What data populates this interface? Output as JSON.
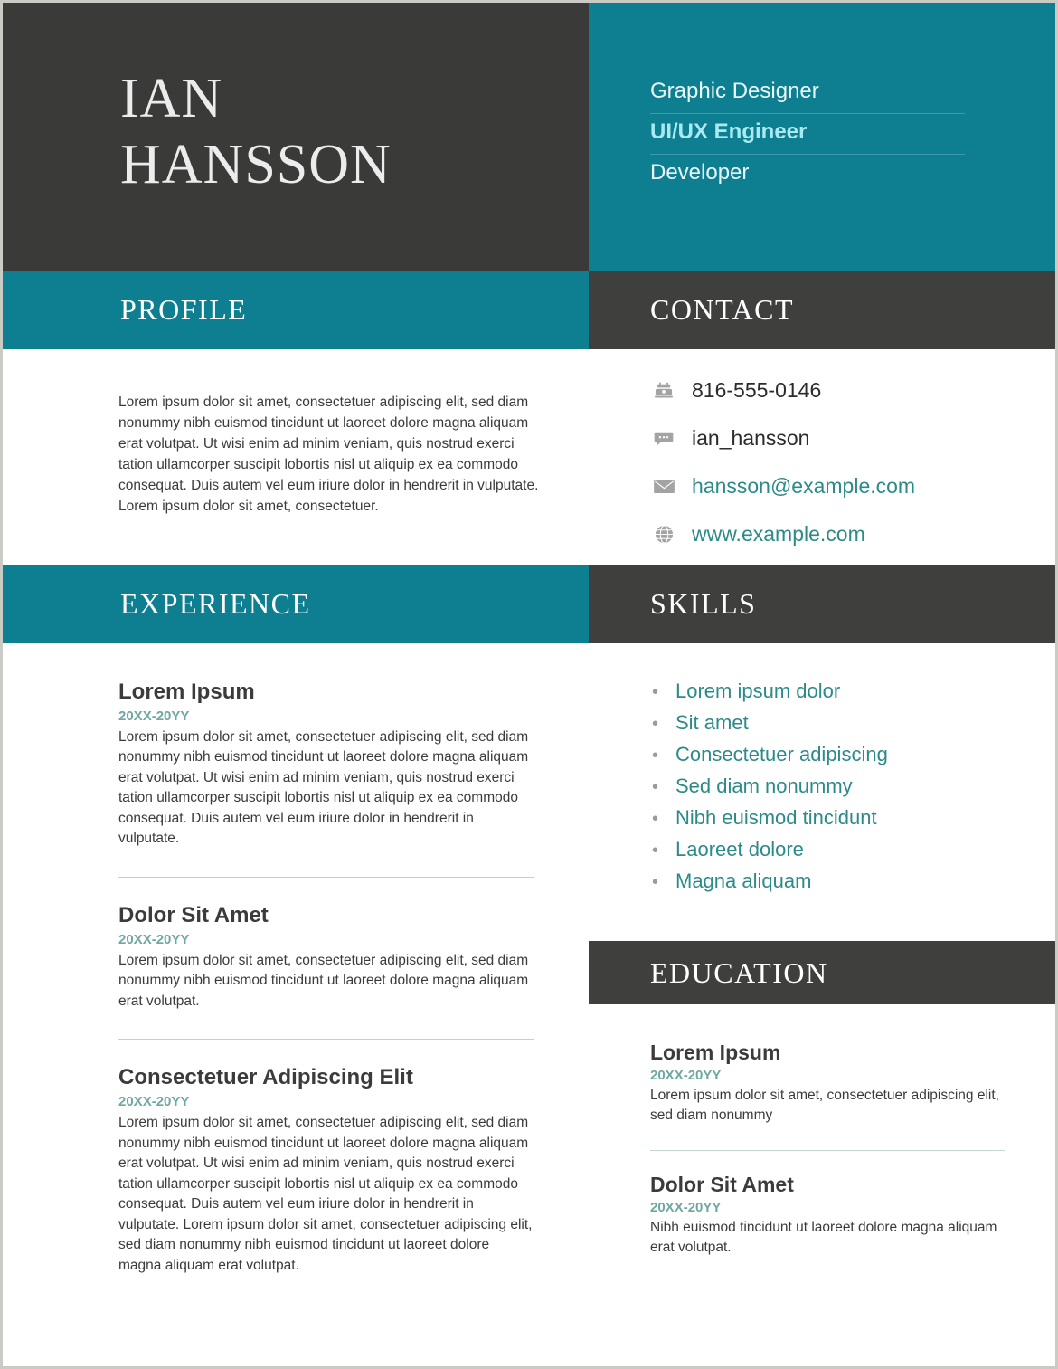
{
  "header": {
    "name_line1": "IAN",
    "name_line2": "HANSSON",
    "titles": [
      {
        "label": "Graphic Designer",
        "emphasis": false
      },
      {
        "label": "UI/UX Engineer",
        "emphasis": true
      },
      {
        "label": "Developer",
        "emphasis": false
      }
    ]
  },
  "colors": {
    "teal": "#0E7E91",
    "dark": "#3A3A38",
    "text_teal": "#2C8A88",
    "date_teal": "#6FA7A4",
    "accent_cyan": "#A9EAF2"
  },
  "profile": {
    "heading": "PROFILE",
    "text": "Lorem ipsum dolor sit amet, consectetuer adipiscing elit, sed diam nonummy nibh euismod tincidunt ut laoreet dolore magna aliquam erat volutpat. Ut wisi enim ad minim veniam, quis nostrud exerci tation ullamcorper suscipit lobortis nisl ut aliquip ex ea commodo consequat. Duis autem vel eum iriure dolor in hendrerit in vulputate. Lorem ipsum dolor sit amet, consectetuer."
  },
  "contact": {
    "heading": "CONTACT",
    "items": [
      {
        "icon": "phone-icon",
        "value": "816-555-0146",
        "is_link": false
      },
      {
        "icon": "chat-bubble-icon",
        "value": "ian_hansson",
        "is_link": false
      },
      {
        "icon": "envelope-icon",
        "value": "hansson@example.com",
        "is_link": true
      },
      {
        "icon": "globe-icon",
        "value": "www.example.com",
        "is_link": true
      }
    ]
  },
  "experience": {
    "heading": "EXPERIENCE",
    "entries": [
      {
        "title": "Lorem Ipsum",
        "date": "20XX-20YY",
        "description": "Lorem ipsum dolor sit amet, consectetuer adipiscing elit, sed diam nonummy nibh euismod tincidunt ut laoreet dolore magna aliquam erat volutpat. Ut wisi enim ad minim veniam, quis nostrud exerci tation ullamcorper suscipit lobortis nisl ut aliquip ex ea commodo consequat. Duis autem vel eum iriure dolor in hendrerit in vulputate."
      },
      {
        "title": "Dolor Sit Amet",
        "date": "20XX-20YY",
        "description": "Lorem ipsum dolor sit amet, consectetuer adipiscing elit, sed diam nonummy nibh euismod tincidunt ut laoreet dolore magna aliquam erat volutpat."
      },
      {
        "title": "Consectetuer Adipiscing Elit",
        "date": "20XX-20YY",
        "description": "Lorem ipsum dolor sit amet, consectetuer adipiscing elit, sed diam nonummy nibh euismod tincidunt ut laoreet dolore magna aliquam erat volutpat. Ut wisi enim ad minim veniam, quis nostrud exerci tation ullamcorper suscipit lobortis nisl ut aliquip ex ea commodo consequat. Duis autem vel eum iriure dolor in hendrerit in vulputate. Lorem ipsum dolor sit amet, consectetuer adipiscing elit, sed diam nonummy nibh euismod tincidunt ut laoreet dolore magna aliquam erat volutpat."
      }
    ]
  },
  "skills": {
    "heading": "SKILLS",
    "items": [
      "Lorem ipsum dolor",
      "Sit amet",
      "Consectetuer adipiscing",
      "Sed diam nonummy",
      "Nibh euismod tincidunt",
      "Laoreet dolore",
      "Magna aliquam"
    ]
  },
  "education": {
    "heading": "EDUCATION",
    "entries": [
      {
        "title": "Lorem Ipsum",
        "date": "20XX-20YY",
        "description": "Lorem ipsum dolor sit amet, consectetuer adipiscing elit, sed diam nonummy"
      },
      {
        "title": "Dolor Sit Amet",
        "date": "20XX-20YY",
        "description": "Nibh euismod tincidunt ut laoreet dolore magna aliquam erat volutpat."
      }
    ]
  }
}
